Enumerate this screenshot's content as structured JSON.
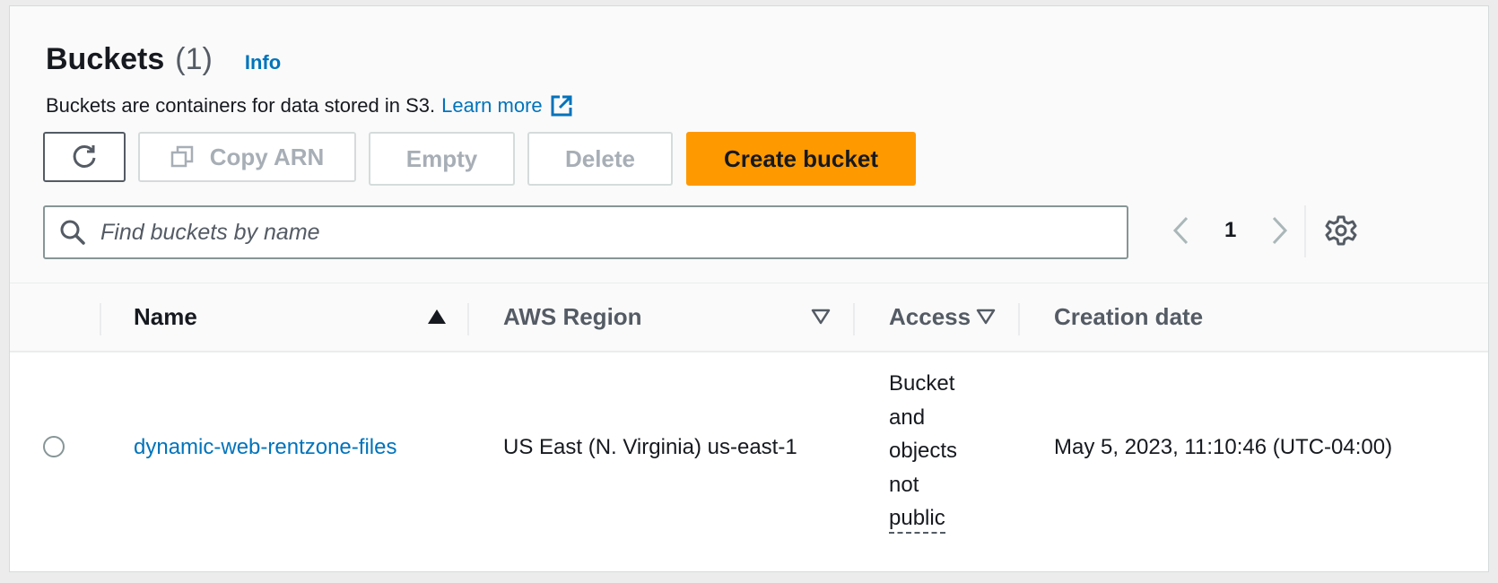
{
  "header": {
    "title": "Buckets",
    "count": "(1)",
    "info_label": "Info",
    "description": "Buckets are containers for data stored in S3.",
    "learn_more": "Learn more"
  },
  "toolbar": {
    "copy_arn_label": "Copy ARN",
    "empty_label": "Empty",
    "delete_label": "Delete",
    "create_bucket_label": "Create bucket"
  },
  "search": {
    "placeholder": "Find buckets by name",
    "value": ""
  },
  "pagination": {
    "current_page": "1"
  },
  "table": {
    "columns": [
      "Name",
      "AWS Region",
      "Access",
      "Creation date"
    ],
    "rows": [
      {
        "name": "dynamic-web-rentzone-files",
        "region": "US East (N. Virginia) us-east-1",
        "access_lines": [
          "Bucket",
          "and",
          "objects",
          "not",
          "public"
        ],
        "creation_date": "May 5, 2023, 11:10:46 (UTC-04:00)"
      }
    ]
  },
  "colors": {
    "primary_button": "#ff9900",
    "link": "#0073bb",
    "disabled_text": "#a7aeb6"
  },
  "icons": [
    "refresh-icon",
    "copy-icon",
    "external-link-icon",
    "search-icon",
    "chevron-left-icon",
    "chevron-right-icon",
    "gear-icon",
    "sort-ascending-icon",
    "sort-descending-icon",
    "radio-button"
  ]
}
